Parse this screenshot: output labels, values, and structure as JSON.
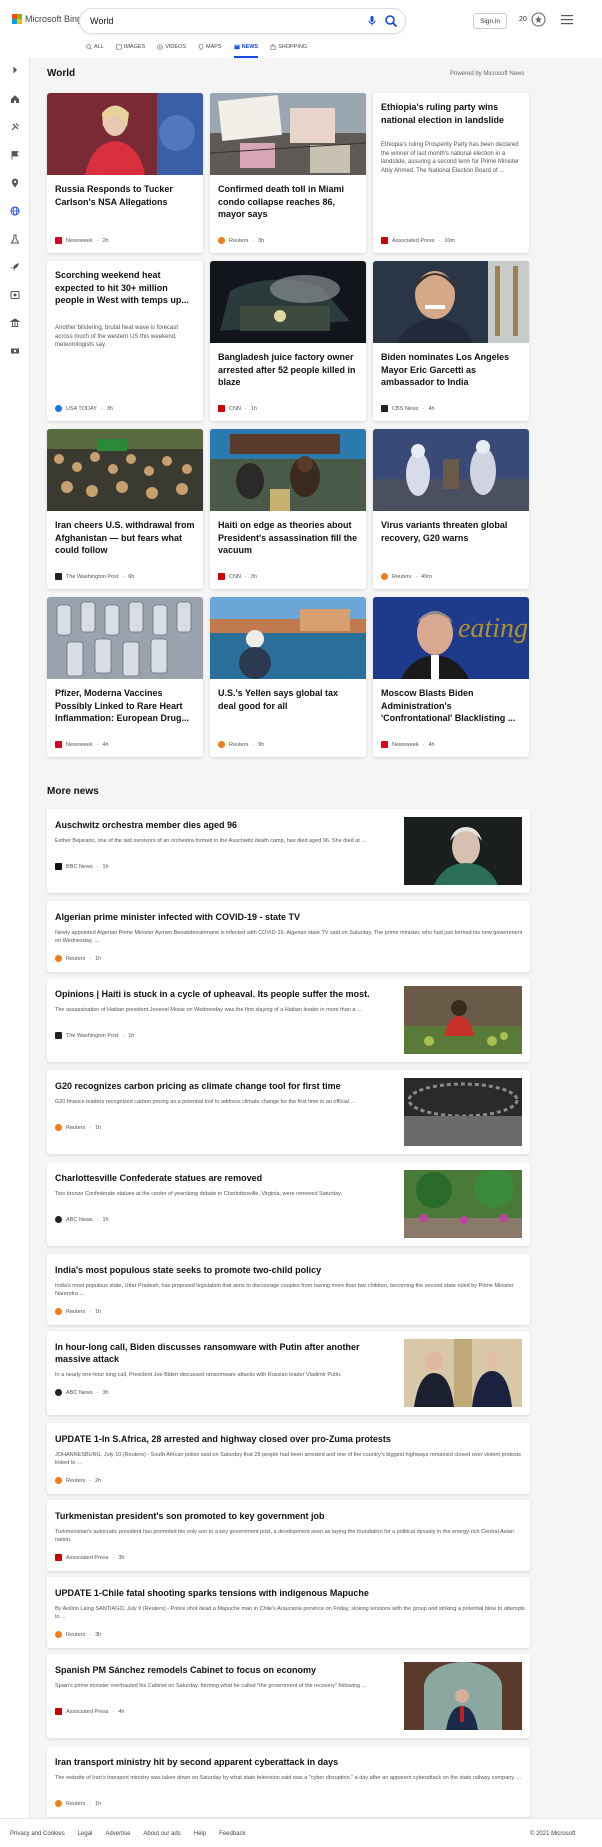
{
  "brand": {
    "name": "Microsoft Bing"
  },
  "search": {
    "query": "World"
  },
  "header": {
    "sign_in": "Sign in",
    "rewards_count": "20"
  },
  "scopes": [
    {
      "label": "ALL",
      "icon": "search-icon"
    },
    {
      "label": "IMAGES",
      "icon": "image-icon"
    },
    {
      "label": "VIDEOS",
      "icon": "video-icon"
    },
    {
      "label": "MAPS",
      "icon": "map-pin-icon"
    },
    {
      "label": "NEWS",
      "icon": "news-icon",
      "active": true
    },
    {
      "label": "SHOPPING",
      "icon": "shopping-bag-icon"
    }
  ],
  "sidebar": {
    "items": [
      "expand-icon",
      "home-icon",
      "tools-icon",
      "flag-icon",
      "location-icon",
      "globe-icon",
      "science-icon",
      "rocket-icon",
      "entertainment-icon",
      "bank-icon",
      "money-icon"
    ]
  },
  "section": {
    "title": "World",
    "powered_by": "Powered by Microsoft News"
  },
  "cards": [
    {
      "title": "Russia Responds to Tucker Carlson's NSA Allegations",
      "provider": "Newsweek",
      "time": "2h",
      "provider_color": "#e0001b"
    },
    {
      "title": "Confirmed death toll in Miami condo collapse reaches 86, mayor says",
      "provider": "Reuters",
      "time": "3h",
      "provider_color": "#f07c1a"
    },
    {
      "title": "Ethiopia's ruling party wins national election in landslide",
      "desc": "Ethiopia's ruling Prosperity Party has been declared the winner of last month's national election in a landslide, assuring a second term for Prime Minister Abiy Ahmed. The National Election Board of ...",
      "provider": "Associated Press",
      "time": "10m",
      "provider_color": "#cc0000"
    },
    {
      "title": "Scorching weekend heat expected to hit 30+ million people in West with temps up...",
      "desc": "Another blistering, brutal heat wave is forecast across much of the western US this weekend, meteorologists say.",
      "provider": "USA TODAY",
      "time": "3h",
      "provider_color": "#1a73e8"
    },
    {
      "title": "Bangladesh juice factory owner arrested after 52 people killed in blaze",
      "provider": "CNN",
      "time": "1h",
      "provider_color": "#cc0000"
    },
    {
      "title": "Biden nominates Los Angeles Mayor Eric Garcetti as ambassador to India",
      "provider": "CBS News",
      "time": "4h",
      "provider_color": "#222222"
    },
    {
      "title": "Iran cheers U.S. withdrawal from Afghanistan — but fears what could follow",
      "provider": "The Washington Post",
      "time": "6h",
      "provider_color": "#222222"
    },
    {
      "title": "Haiti on edge as theories about President's assassination fill the vacuum",
      "provider": "CNN",
      "time": "3h",
      "provider_color": "#cc0000"
    },
    {
      "title": "Virus variants threaten global recovery, G20 warns",
      "provider": "Reuters",
      "time": "49m",
      "provider_color": "#f07c1a"
    },
    {
      "title": "Pfizer, Moderna Vaccines Possibly Linked to Rare Heart Inflammation: European Drug...",
      "provider": "Newsweek",
      "time": "4h",
      "provider_color": "#e0001b"
    },
    {
      "title": "U.S.'s Yellen says global tax deal good for all",
      "provider": "Reuters",
      "time": "9h",
      "provider_color": "#f07c1a"
    },
    {
      "title": "Moscow Blasts Biden Administration's 'Confrontational' Blacklisting ...",
      "provider": "Newsweek",
      "time": "4h",
      "provider_color": "#e0001b"
    }
  ],
  "more_news": {
    "title": "More news",
    "items": [
      {
        "title": "Auschwitz orchestra member dies aged 96",
        "desc": "Esther Bejarano, one of the last survivors of an orchestra formed in the Auschwitz death camp, has died aged 96. She died at ...",
        "provider": "BBC News",
        "time": "1h",
        "provider_color": "#111111"
      },
      {
        "title": "Algerian prime minister infected with COVID-19 - state TV",
        "desc": "Newly appointed Algerian Prime Minister Aymen Benabderrahmane is infected with COVID-19, Algerian state TV said on Saturday. The prime minister, who had just formed his new government on Wednesday, ...",
        "provider": "Reuters",
        "time": "1h",
        "provider_color": "#f07c1a"
      },
      {
        "title": "Opinions | Haiti is stuck in a cycle of upheaval. Its people suffer the most.",
        "desc": "The assassination of Haitian president Jovenel Moise on Wednesday was the first slaying of a Haitian leader in more than a ...",
        "provider": "The Washington Post",
        "time": "1h",
        "provider_color": "#222222"
      },
      {
        "title": "G20 recognizes carbon pricing as climate change tool for first time",
        "desc": "G20 finance leaders recognized carbon pricing as a potential tool to address climate change for the first time in an official ...",
        "provider": "Reuters",
        "time": "1h",
        "provider_color": "#f07c1a"
      },
      {
        "title": "Charlottesville Confederate statues are removed",
        "desc": "Two bronze Confederate statues at the center of yearslong debate in Charlottesville, Virginia, were removed Saturday.",
        "provider": "ABC News",
        "time": "1h",
        "provider_color": "#222222"
      },
      {
        "title": "India's most populous state seeks to promote two-child policy",
        "desc": "India's most populous state, Uttar Pradesh, has proposed legislation that aims to discourage couples from having more than two children, becoming the second state ruled by Prime Minister Narendra ...",
        "provider": "Reuters",
        "time": "1h",
        "provider_color": "#f07c1a"
      },
      {
        "title": "In hour-long call, Biden discusses ransomware with Putin after another massive attack",
        "desc": "In a nearly one-hour long call, President Joe Biden discussed ransomware attacks with Russian leader Vladimir Putin.",
        "provider": "ABC News",
        "time": "3h",
        "provider_color": "#222222"
      },
      {
        "title": "UPDATE 1-In S.Africa, 28 arrested and highway closed over pro-Zuma protests",
        "desc": "JOHANNESBURG, July 10 (Reuters) - South African police said on Saturday that 28 people had been arrested and one of the country's biggest highways remained closed over violent protests linked to ...",
        "provider": "Reuters",
        "time": "2h",
        "provider_color": "#f07c1a"
      },
      {
        "title": "Turkmenistan president's son promoted to key government job",
        "desc": "Turkmenistan's autocratic president has promoted his only son to a key government post, a development seen as laying the foundation for a political dynasty in the energy-rich Central Asian nation.",
        "provider": "Associated Press",
        "time": "3h",
        "provider_color": "#cc0000"
      },
      {
        "title": "UPDATE 1-Chile fatal shooting sparks tensions with indigenous Mapuche",
        "desc": "By Aislinn Laing SANTIAGO, July 9 (Reuters) - Police shot dead a Mapuche man in Chile's Araucania province on Friday, stoking tensions with the group and striking a potential blow to attempts to ...",
        "provider": "Reuters",
        "time": "3h",
        "provider_color": "#f07c1a"
      },
      {
        "title": "Spanish PM Sánchez remodels Cabinet to focus on economy",
        "desc": "Spain's prime minister overhauled his Cabinet on Saturday, forming what he called \"the government of the recovery\" following ...",
        "provider": "Associated Press",
        "time": "4h",
        "provider_color": "#cc0000"
      },
      {
        "title": "Iran transport ministry hit by second apparent cyberattack in days",
        "desc": "The website of Iran's transport ministry was taken down on Saturday by what state television said was a \"cyber disruption,\" a day after an apparent cyberattack on the state railway company. ...",
        "provider": "Reuters",
        "time": "1h",
        "provider_color": "#f07c1a"
      }
    ]
  },
  "footer": {
    "links": [
      "Privacy and Cookies",
      "Legal",
      "Advertise",
      "About our ads",
      "Help",
      "Feedback"
    ],
    "copyright": "© 2021 Microsoft"
  }
}
